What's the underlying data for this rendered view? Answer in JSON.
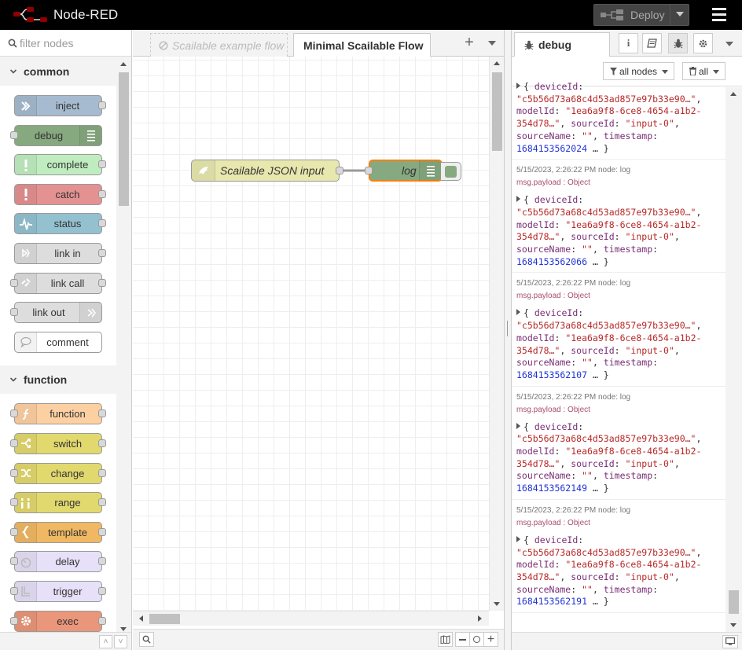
{
  "header": {
    "app_title": "Node-RED",
    "deploy_label": "Deploy"
  },
  "palette": {
    "search_placeholder": "filter nodes",
    "categories": [
      {
        "label": "common",
        "nodes": [
          {
            "label": "inject",
            "color": "#a6bbcf",
            "icon": "arrow-in-icon",
            "in": false,
            "out": true,
            "icon_right": false
          },
          {
            "label": "debug",
            "color": "#87a980",
            "icon": "list-icon",
            "in": true,
            "out": false,
            "icon_right": true
          },
          {
            "label": "complete",
            "color": "#c0edc0",
            "icon": "exclamation-icon",
            "in": false,
            "out": true,
            "icon_right": false
          },
          {
            "label": "catch",
            "color": "#e49191",
            "icon": "exclamation-icon",
            "in": false,
            "out": true,
            "icon_right": false
          },
          {
            "label": "status",
            "color": "#94c1d0",
            "icon": "pulse-icon",
            "in": false,
            "out": true,
            "icon_right": false
          },
          {
            "label": "link in",
            "color": "#dddddd",
            "icon": "link-in-icon",
            "in": false,
            "out": true,
            "icon_right": false
          },
          {
            "label": "link call",
            "color": "#dddddd",
            "icon": "link-call-icon",
            "in": true,
            "out": true,
            "icon_right": false
          },
          {
            "label": "link out",
            "color": "#dddddd",
            "icon": "link-out-icon",
            "in": true,
            "out": false,
            "icon_right": true
          },
          {
            "label": "comment",
            "color": "#ffffff",
            "icon": "comment-icon",
            "in": false,
            "out": false,
            "icon_right": false
          }
        ]
      },
      {
        "label": "function",
        "nodes": [
          {
            "label": "function",
            "color": "#fdd0a2",
            "icon": "function-icon",
            "in": true,
            "out": true,
            "icon_right": false
          },
          {
            "label": "switch",
            "color": "#e2d96e",
            "icon": "switch-icon",
            "in": true,
            "out": true,
            "icon_right": false
          },
          {
            "label": "change",
            "color": "#e2d96e",
            "icon": "shuffle-icon",
            "in": true,
            "out": true,
            "icon_right": false
          },
          {
            "label": "range",
            "color": "#e2d96e",
            "icon": "range-icon",
            "in": true,
            "out": true,
            "icon_right": false
          },
          {
            "label": "template",
            "color": "#f0b862",
            "icon": "brace-icon",
            "in": true,
            "out": true,
            "icon_right": false
          },
          {
            "label": "delay",
            "color": "#e6e0f8",
            "icon": "timer-icon",
            "in": true,
            "out": true,
            "icon_right": false
          },
          {
            "label": "trigger",
            "color": "#e6e0f8",
            "icon": "trigger-icon",
            "in": true,
            "out": true,
            "icon_right": false
          },
          {
            "label": "exec",
            "color": "#e9967a",
            "icon": "gear-icon",
            "in": true,
            "out": true,
            "icon_right": false
          }
        ]
      }
    ]
  },
  "workspace": {
    "tabs": [
      {
        "label": "Scailable example flow",
        "disabled": true
      },
      {
        "label": "Minimal Scailable Flow",
        "active": true
      }
    ],
    "nodes": [
      {
        "label": "Scailable JSON input",
        "color": "#e7e7ae"
      },
      {
        "label": "log",
        "color": "#87a980"
      }
    ],
    "selection_color": "#ff7f0e"
  },
  "sidebar": {
    "tab_label": "debug",
    "filter_nodes_label": "all nodes",
    "clear_label": "all",
    "messages": [
      {
        "meta": "",
        "path": "",
        "deviceId": "\"c5b56d73a68c4d53ad857e97b33e90…\"",
        "modelId": "\"1ea6a9f8-6ce8-4654-a1b2-354d78…\"",
        "sourceId": "\"input-0\"",
        "sourceName": "\"\"",
        "timestamp": "1684153562024"
      },
      {
        "meta": "5/15/2023, 2:26:22 PM    node: log",
        "path": "msg.payload : Object",
        "deviceId": "\"c5b56d73a68c4d53ad857e97b33e90…\"",
        "modelId": "\"1ea6a9f8-6ce8-4654-a1b2-354d78…\"",
        "sourceId": "\"input-0\"",
        "sourceName": "\"\"",
        "timestamp": "1684153562066"
      },
      {
        "meta": "5/15/2023, 2:26:22 PM    node: log",
        "path": "msg.payload : Object",
        "deviceId": "\"c5b56d73a68c4d53ad857e97b33e90…\"",
        "modelId": "\"1ea6a9f8-6ce8-4654-a1b2-354d78…\"",
        "sourceId": "\"input-0\"",
        "sourceName": "\"\"",
        "timestamp": "1684153562107"
      },
      {
        "meta": "5/15/2023, 2:26:22 PM    node: log",
        "path": "msg.payload : Object",
        "deviceId": "\"c5b56d73a68c4d53ad857e97b33e90…\"",
        "modelId": "\"1ea6a9f8-6ce8-4654-a1b2-354d78…\"",
        "sourceId": "\"input-0\"",
        "sourceName": "\"\"",
        "timestamp": "1684153562149"
      },
      {
        "meta": "5/15/2023, 2:26:22 PM    node: log",
        "path": "msg.payload : Object",
        "deviceId": "\"c5b56d73a68c4d53ad857e97b33e90…\"",
        "modelId": "\"1ea6a9f8-6ce8-4654-a1b2-354d78…\"",
        "sourceId": "\"input-0\"",
        "sourceName": "\"\"",
        "timestamp": "1684153562191"
      }
    ]
  }
}
